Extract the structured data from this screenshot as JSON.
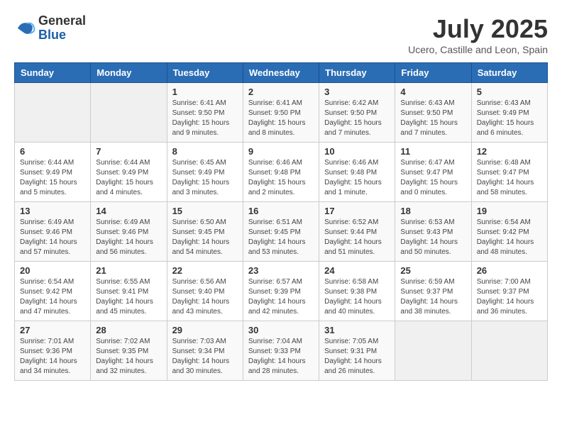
{
  "logo": {
    "general": "General",
    "blue": "Blue"
  },
  "title": "July 2025",
  "location": "Ucero, Castille and Leon, Spain",
  "days_header": [
    "Sunday",
    "Monday",
    "Tuesday",
    "Wednesday",
    "Thursday",
    "Friday",
    "Saturday"
  ],
  "weeks": [
    [
      {
        "day": "",
        "sunrise": "",
        "sunset": "",
        "daylight": ""
      },
      {
        "day": "",
        "sunrise": "",
        "sunset": "",
        "daylight": ""
      },
      {
        "day": "1",
        "sunrise": "Sunrise: 6:41 AM",
        "sunset": "Sunset: 9:50 PM",
        "daylight": "Daylight: 15 hours and 9 minutes."
      },
      {
        "day": "2",
        "sunrise": "Sunrise: 6:41 AM",
        "sunset": "Sunset: 9:50 PM",
        "daylight": "Daylight: 15 hours and 8 minutes."
      },
      {
        "day": "3",
        "sunrise": "Sunrise: 6:42 AM",
        "sunset": "Sunset: 9:50 PM",
        "daylight": "Daylight: 15 hours and 7 minutes."
      },
      {
        "day": "4",
        "sunrise": "Sunrise: 6:43 AM",
        "sunset": "Sunset: 9:50 PM",
        "daylight": "Daylight: 15 hours and 7 minutes."
      },
      {
        "day": "5",
        "sunrise": "Sunrise: 6:43 AM",
        "sunset": "Sunset: 9:49 PM",
        "daylight": "Daylight: 15 hours and 6 minutes."
      }
    ],
    [
      {
        "day": "6",
        "sunrise": "Sunrise: 6:44 AM",
        "sunset": "Sunset: 9:49 PM",
        "daylight": "Daylight: 15 hours and 5 minutes."
      },
      {
        "day": "7",
        "sunrise": "Sunrise: 6:44 AM",
        "sunset": "Sunset: 9:49 PM",
        "daylight": "Daylight: 15 hours and 4 minutes."
      },
      {
        "day": "8",
        "sunrise": "Sunrise: 6:45 AM",
        "sunset": "Sunset: 9:49 PM",
        "daylight": "Daylight: 15 hours and 3 minutes."
      },
      {
        "day": "9",
        "sunrise": "Sunrise: 6:46 AM",
        "sunset": "Sunset: 9:48 PM",
        "daylight": "Daylight: 15 hours and 2 minutes."
      },
      {
        "day": "10",
        "sunrise": "Sunrise: 6:46 AM",
        "sunset": "Sunset: 9:48 PM",
        "daylight": "Daylight: 15 hours and 1 minute."
      },
      {
        "day": "11",
        "sunrise": "Sunrise: 6:47 AM",
        "sunset": "Sunset: 9:47 PM",
        "daylight": "Daylight: 15 hours and 0 minutes."
      },
      {
        "day": "12",
        "sunrise": "Sunrise: 6:48 AM",
        "sunset": "Sunset: 9:47 PM",
        "daylight": "Daylight: 14 hours and 58 minutes."
      }
    ],
    [
      {
        "day": "13",
        "sunrise": "Sunrise: 6:49 AM",
        "sunset": "Sunset: 9:46 PM",
        "daylight": "Daylight: 14 hours and 57 minutes."
      },
      {
        "day": "14",
        "sunrise": "Sunrise: 6:49 AM",
        "sunset": "Sunset: 9:46 PM",
        "daylight": "Daylight: 14 hours and 56 minutes."
      },
      {
        "day": "15",
        "sunrise": "Sunrise: 6:50 AM",
        "sunset": "Sunset: 9:45 PM",
        "daylight": "Daylight: 14 hours and 54 minutes."
      },
      {
        "day": "16",
        "sunrise": "Sunrise: 6:51 AM",
        "sunset": "Sunset: 9:45 PM",
        "daylight": "Daylight: 14 hours and 53 minutes."
      },
      {
        "day": "17",
        "sunrise": "Sunrise: 6:52 AM",
        "sunset": "Sunset: 9:44 PM",
        "daylight": "Daylight: 14 hours and 51 minutes."
      },
      {
        "day": "18",
        "sunrise": "Sunrise: 6:53 AM",
        "sunset": "Sunset: 9:43 PM",
        "daylight": "Daylight: 14 hours and 50 minutes."
      },
      {
        "day": "19",
        "sunrise": "Sunrise: 6:54 AM",
        "sunset": "Sunset: 9:42 PM",
        "daylight": "Daylight: 14 hours and 48 minutes."
      }
    ],
    [
      {
        "day": "20",
        "sunrise": "Sunrise: 6:54 AM",
        "sunset": "Sunset: 9:42 PM",
        "daylight": "Daylight: 14 hours and 47 minutes."
      },
      {
        "day": "21",
        "sunrise": "Sunrise: 6:55 AM",
        "sunset": "Sunset: 9:41 PM",
        "daylight": "Daylight: 14 hours and 45 minutes."
      },
      {
        "day": "22",
        "sunrise": "Sunrise: 6:56 AM",
        "sunset": "Sunset: 9:40 PM",
        "daylight": "Daylight: 14 hours and 43 minutes."
      },
      {
        "day": "23",
        "sunrise": "Sunrise: 6:57 AM",
        "sunset": "Sunset: 9:39 PM",
        "daylight": "Daylight: 14 hours and 42 minutes."
      },
      {
        "day": "24",
        "sunrise": "Sunrise: 6:58 AM",
        "sunset": "Sunset: 9:38 PM",
        "daylight": "Daylight: 14 hours and 40 minutes."
      },
      {
        "day": "25",
        "sunrise": "Sunrise: 6:59 AM",
        "sunset": "Sunset: 9:37 PM",
        "daylight": "Daylight: 14 hours and 38 minutes."
      },
      {
        "day": "26",
        "sunrise": "Sunrise: 7:00 AM",
        "sunset": "Sunset: 9:37 PM",
        "daylight": "Daylight: 14 hours and 36 minutes."
      }
    ],
    [
      {
        "day": "27",
        "sunrise": "Sunrise: 7:01 AM",
        "sunset": "Sunset: 9:36 PM",
        "daylight": "Daylight: 14 hours and 34 minutes."
      },
      {
        "day": "28",
        "sunrise": "Sunrise: 7:02 AM",
        "sunset": "Sunset: 9:35 PM",
        "daylight": "Daylight: 14 hours and 32 minutes."
      },
      {
        "day": "29",
        "sunrise": "Sunrise: 7:03 AM",
        "sunset": "Sunset: 9:34 PM",
        "daylight": "Daylight: 14 hours and 30 minutes."
      },
      {
        "day": "30",
        "sunrise": "Sunrise: 7:04 AM",
        "sunset": "Sunset: 9:33 PM",
        "daylight": "Daylight: 14 hours and 28 minutes."
      },
      {
        "day": "31",
        "sunrise": "Sunrise: 7:05 AM",
        "sunset": "Sunset: 9:31 PM",
        "daylight": "Daylight: 14 hours and 26 minutes."
      },
      {
        "day": "",
        "sunrise": "",
        "sunset": "",
        "daylight": ""
      },
      {
        "day": "",
        "sunrise": "",
        "sunset": "",
        "daylight": ""
      }
    ]
  ]
}
